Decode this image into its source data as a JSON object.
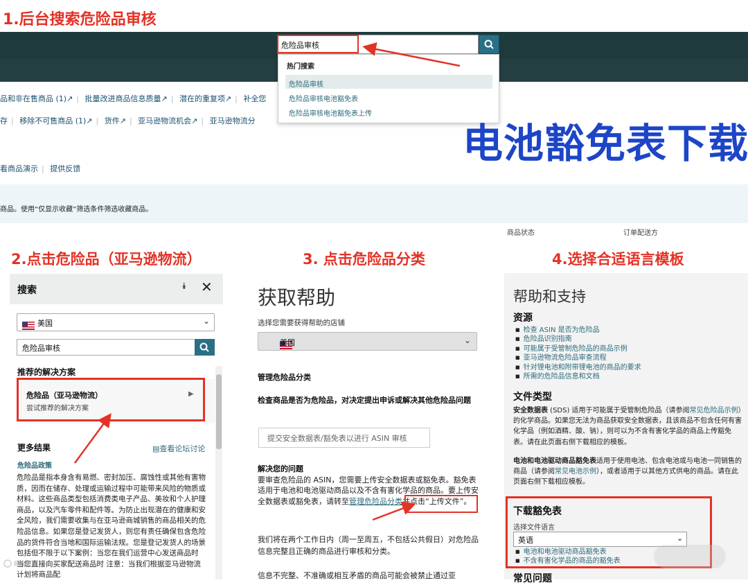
{
  "steps": {
    "step1": "1.后台搜索危险品审核",
    "step2": "2.点击危险品（亚马逊物流）",
    "step3": "3. 点击危险品分类",
    "step4": "4.选择合适语言模板"
  },
  "big_title": "电池豁免表下载",
  "header_search": {
    "value": "危险品审核",
    "hot_label": "热门搜索",
    "suggestions": [
      "危险品审核",
      "危险品审核电池豁免表",
      "危险品审核电池豁免表上传"
    ]
  },
  "background_links": {
    "row1": [
      "品和非在售商品 (1)",
      "批量改进商品信息质量",
      "潜在的重复项",
      "补全您"
    ],
    "row2": [
      "存",
      "移除不可售商品 (1)",
      "货件",
      "亚马逊物流机会",
      "亚马逊物流分"
    ],
    "row3": [
      "看商品演示",
      "提供反馈"
    ],
    "info_text": "商品。使用“仅显示收藏”筛选条件筛选收藏商品。",
    "col_status": "商品状态",
    "col_shipping": "订单配送方"
  },
  "panel2": {
    "title": "搜索",
    "country": "美国",
    "search_value": "危险品审核",
    "recommended_label": "推荐的解决方案",
    "card_title": "危险品（亚马逊物流）",
    "card_sub": "尝试推荐的解决方案",
    "more_results": "更多结果",
    "forum_link": "查看论坛讨论",
    "policy_link": "危险品政策",
    "body": "危险品是指本身含有易燃、密封加压、腐蚀性或其他有害物质，因而在储存、处理或运输过程中可能带来风险的物质或材料。这些商品类型包括消费类电子产品、美妆和个人护理商品，以及汽车零件和配件等。为防止出现潜在的健康和安全风险，我们需要收集与在亚马逊商城销售的商品相关的危险品信息。如果您是登记发货人，则您有责任确保包含危险品的货件符合当地和国际运输法规。您是登记发货人的场景包括但不限于以下案例：当您在我们运营中心发送商品时 当您直接向买家配送商品时 注意：当我们根据亚马逊物流计划将商品配"
  },
  "panel3": {
    "title": "获取帮助",
    "store_label": "选择您需要获得帮助的店铺",
    "country": "美国",
    "manage_heading": "管理危险品分类",
    "check_heading": "检查商品是否为危险品，对决定提出申诉或解决其他危险品问题",
    "asin_button": "提交安全数据表/豁免表以进行 ASIN 审核",
    "solve_heading": "解决您的问题",
    "solve_body_pre": "要审查危险品的 ASIN，您需要上传安全数据表或豁免表。豁免表适用于电池和电池驱动商品以及不含有害化学品的商品。要上传安全数据表或豁免表，请转至",
    "solve_link": "管理危险品分类",
    "solve_body_post": "并点击“上传文件”。",
    "review_text": "我们将在两个工作日内（周一至周五，不包括公共假日）对危险品信息完整且正确的商品进行审核和分类。",
    "incomplete_text": "信息不完整、不准确或相互矛盾的商品可能会被禁止通过亚"
  },
  "panel4": {
    "title": "帮助和支持",
    "resources_heading": "资源",
    "resources": [
      "检查 ASIN 是否为危险品",
      "危险品识别指南",
      "可能属于受管制危险品的商品示例",
      "亚马逊物流危险品审查流程",
      "针对锂电池和附带锂电池的商品的要求",
      "所需的危险品信息和文档"
    ],
    "file_types_heading": "文件类型",
    "sds_term": "安全数据表",
    "sds_pre": " (SDS) 适用于可能属于受管制危险品（请参阅",
    "sds_link": "常见危险品示例",
    "sds_post": "）的化学商品。如果您无法为商品获取安全数据表，且该商品不包含任何有害化学品（例如酒精、酸、钠），则可以为不含有害化学品的商品上传豁免表。请在此页面右侧下载相应的模板。",
    "battery_term": "电池和电池驱动商品豁免表",
    "battery_pre": "适用于使用电池、包含电池或与电池一同销售的商品（请参阅",
    "battery_link": "常见电池示例",
    "battery_post": "），或者适用于以其他方式供电的商品。请在此页面右侧下载相应模板。",
    "download_heading": "下载豁免表",
    "lang_label": "选择文件语言",
    "lang_value": "英语",
    "downloads": [
      "电池和电池驱动商品豁免表",
      "不含有害化学品的商品的豁免表"
    ],
    "faq_heading": "常见问题"
  },
  "colors": {
    "accent_red": "#e33226",
    "title_blue": "#1d45c7",
    "nav_dark": "#1e3a3d",
    "link_teal": "#2a6a7a",
    "button_teal": "#2a6f86"
  }
}
